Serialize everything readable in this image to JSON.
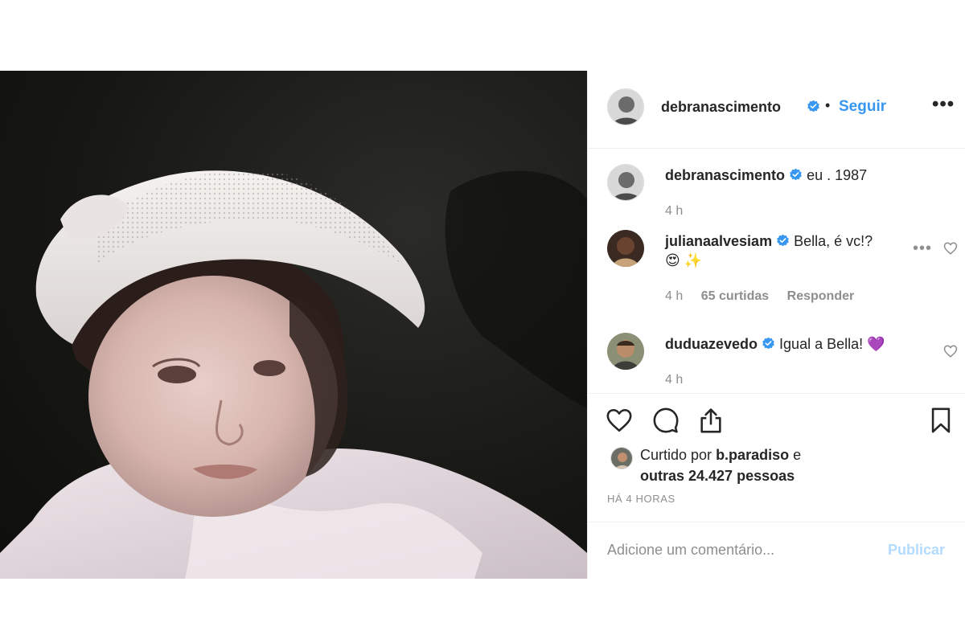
{
  "post": {
    "author": "debranascimento",
    "follow_label": "Seguir",
    "separator": "•",
    "more_label": "•••"
  },
  "caption": {
    "username": "debranascimento",
    "text": "eu . 1987",
    "time": "4 h"
  },
  "comments": [
    {
      "username": "julianaalvesiam",
      "text": "Bella, é vc!?",
      "emoji": "😍 ✨",
      "time": "4 h",
      "likes": "65 curtidas",
      "reply_label": "Responder"
    },
    {
      "username": "duduazevedo",
      "text": "Igual a Bella!",
      "emoji": "💜",
      "time": "4 h",
      "likes": "",
      "reply_label": ""
    }
  ],
  "likes": {
    "prefix": "Curtido por",
    "user": "b.paradiso",
    "conj": "e",
    "others": "outras 24.427 pessoas"
  },
  "timeago": "HÁ 4 HORAS",
  "add_comment": {
    "placeholder": "Adicione um comentário...",
    "publish_label": "Publicar"
  },
  "icons": {
    "verified": "verified-badge-icon",
    "like": "heart-icon",
    "comment": "comment-bubble-icon",
    "share": "share-icon",
    "save": "bookmark-icon"
  },
  "colors": {
    "accent": "#3897f0",
    "verified": "#3897f0",
    "publish_disabled": "#b3dbff",
    "meta": "#8e8e8e",
    "emoji_heart": "#9b51e0"
  }
}
